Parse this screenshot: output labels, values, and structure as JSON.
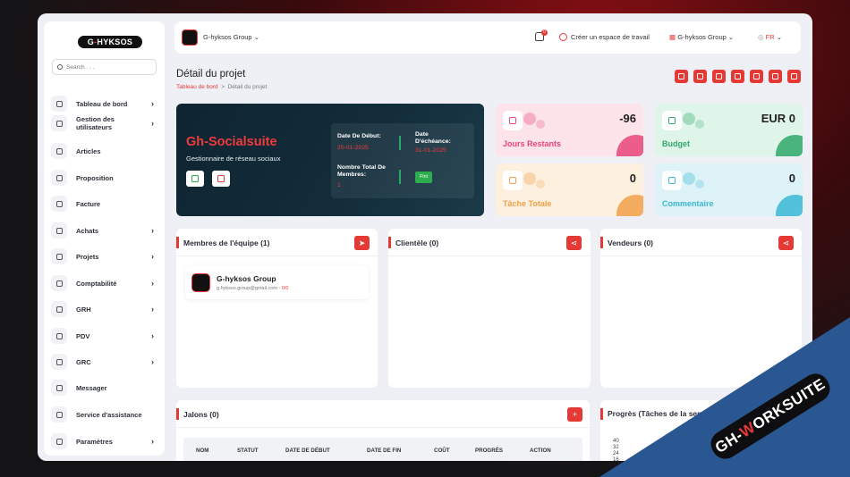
{
  "brand": {
    "logo_prefix": "G",
    "logo_accent": "-",
    "logo_rest": "HYKSOS"
  },
  "sidebar": {
    "search_placeholder": "Search . . .",
    "items": [
      {
        "label": "Tableau de bord",
        "chevron": true,
        "icon": "home-icon"
      },
      {
        "label": "Gestion des utilisateurs",
        "chevron": true,
        "icon": "users-icon"
      },
      {
        "label": "Articles",
        "chevron": false,
        "icon": "cart-icon"
      },
      {
        "label": "Proposition",
        "chevron": false,
        "icon": "swap-icon"
      },
      {
        "label": "Facture",
        "chevron": false,
        "icon": "invoice-icon"
      },
      {
        "label": "Achats",
        "chevron": true,
        "icon": "cart-icon"
      },
      {
        "label": "Projets",
        "chevron": true,
        "icon": "check-square-icon"
      },
      {
        "label": "Comptabilité",
        "chevron": true,
        "icon": "grid-icon"
      },
      {
        "label": "GRH",
        "chevron": true,
        "icon": "network-icon"
      },
      {
        "label": "PDV",
        "chevron": true,
        "icon": "dots-grid-icon"
      },
      {
        "label": "GRC",
        "chevron": true,
        "icon": "copy-icon"
      },
      {
        "label": "Messager",
        "chevron": false,
        "icon": "chat-icon"
      },
      {
        "label": "Service d'assistance",
        "chevron": false,
        "icon": "headset-icon"
      },
      {
        "label": "Paramètres",
        "chevron": true,
        "icon": "gear-icon"
      }
    ]
  },
  "header": {
    "workspace": "G-hyksos Group",
    "notification_count": "0",
    "create_workspace": "Créer un espace de travail",
    "company": "G-hyksos Group",
    "language": "FR"
  },
  "page": {
    "title": "Détail du projet",
    "breadcrumb_home": "Tableau de bord",
    "breadcrumb_sep": ">",
    "breadcrumb_current": "Détail du projet"
  },
  "project": {
    "name": "Gh-Socialsuite",
    "description": "Gestionnaire de réseau sociaux",
    "start_label": "Date De Début:",
    "start_value": "20-01-2025",
    "due_label": "Date D'échéance:",
    "due_value": "31-01-2025",
    "members_label": "Nombre Total De Membres:",
    "members_value": "1",
    "status": "Fini"
  },
  "stats": [
    {
      "label": "Jours Restants",
      "value": "-96",
      "bg": "#fde3ea",
      "accent": "#e8457a",
      "icon": "calendar-icon"
    },
    {
      "label": "Budget",
      "value": "EUR 0",
      "bg": "#dff5ea",
      "accent": "#2fa86a",
      "icon": "money-icon"
    },
    {
      "label": "Tâche Totale",
      "value": "0",
      "bg": "#fdf0de",
      "accent": "#f2a14a",
      "icon": "file-icon"
    },
    {
      "label": "Commentaire",
      "value": "0",
      "bg": "#def3f8",
      "accent": "#3bb7d3",
      "icon": "comment-icon"
    }
  ],
  "panels": {
    "team": "Membres de l'équipe (1)",
    "clients": "Clientèle (0)",
    "vendors": "Vendeurs (0)",
    "milestones": "Jalons (0)",
    "progress": "Progrès (Tâches de la sem"
  },
  "member": {
    "name": "G-hyksos Group",
    "email": "g.hyksos.group@gmail.com - ",
    "score": "0/0"
  },
  "milestone_columns": [
    "NOM",
    "STATUT",
    "DATE DE DÉBUT",
    "DATE DE FIN",
    "COÛT",
    "PROGRÈS",
    "ACTION"
  ],
  "chart_data": {
    "type": "line",
    "title": "",
    "y_ticks": [
      "40",
      "32",
      "24",
      "16"
    ]
  },
  "watermark": {
    "prefix": "GH-",
    "accent": "W",
    "rest": "ORKSUITE"
  }
}
